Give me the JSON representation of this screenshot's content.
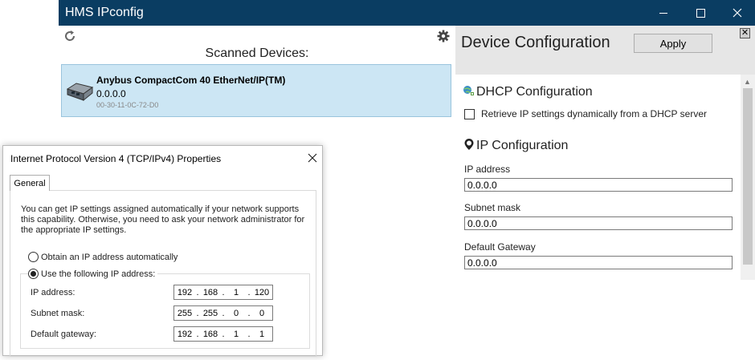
{
  "window": {
    "title": "HMS IPconfig"
  },
  "scan": {
    "title": "Scanned Devices:",
    "devices": [
      {
        "name": "Anybus CompactCom 40 EtherNet/IP(TM)",
        "ip": "0.0.0.0",
        "mac": "00-30-11-0C-72-D0"
      }
    ]
  },
  "config": {
    "title": "Device Configuration",
    "apply_label": "Apply",
    "close_glyph": "✕",
    "dhcp": {
      "title": "DHCP Configuration",
      "checkbox_label": "Retrieve IP settings dynamically from a DHCP server",
      "checked": false
    },
    "ip": {
      "title": "IP Configuration",
      "ip_address_label": "IP address",
      "ip_address_value": "0.0.0.0",
      "subnet_label": "Subnet mask",
      "subnet_value": "0.0.0.0",
      "gateway_label": "Default Gateway",
      "gateway_value": "0.0.0.0"
    }
  },
  "dialog": {
    "title": "Internet Protocol Version 4 (TCP/IPv4) Properties",
    "tab_label": "General",
    "intro": "You can get IP settings assigned automatically if your network supports this capability. Otherwise, you need to ask your network administrator for the appropriate IP settings.",
    "radio_auto": "Obtain an IP address automatically",
    "radio_manual": "Use the following IP address:",
    "ip_label": "IP address:",
    "ip_octets": [
      "192",
      "168",
      "1",
      "120"
    ],
    "subnet_label": "Subnet mask:",
    "subnet_octets": [
      "255",
      "255",
      "0",
      "0"
    ],
    "gateway_label": "Default gateway:",
    "gateway_octets": [
      "192",
      "168",
      "1",
      "1"
    ]
  },
  "colors": {
    "titlebar": "#0a3d62",
    "selected_device": "#cce6f4"
  }
}
